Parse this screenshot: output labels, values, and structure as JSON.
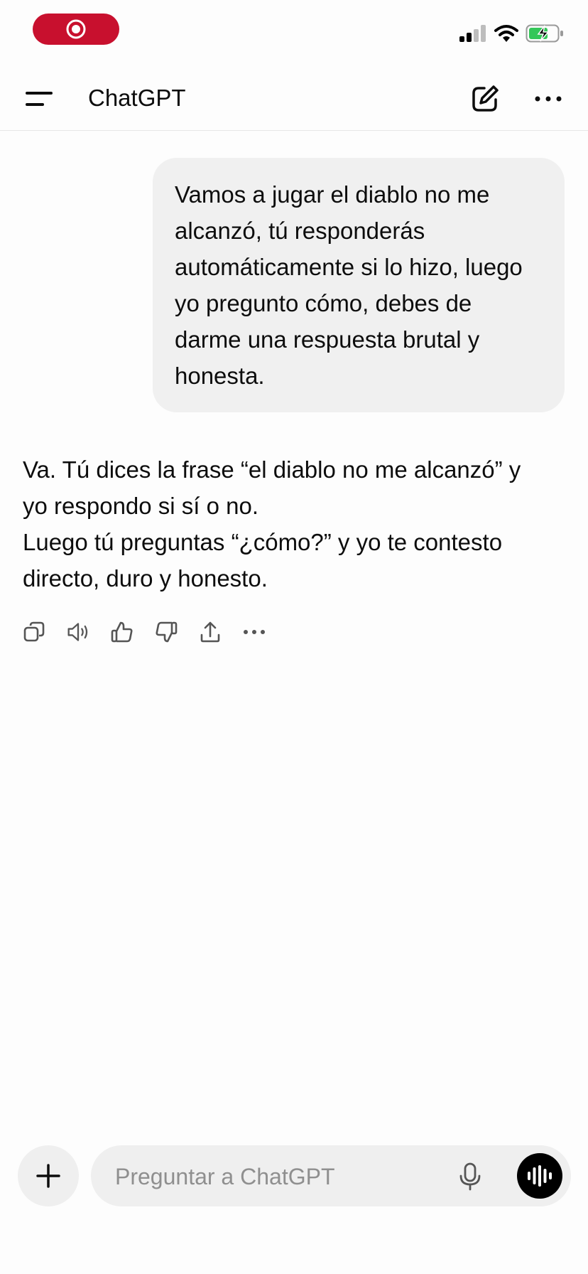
{
  "app": {
    "title": "ChatGPT"
  },
  "status_bar": {
    "recording": true,
    "battery": "charging"
  },
  "conversation": {
    "user_message": "Vamos a jugar el diablo no me alcanzó, tú responderás automáticamente si lo hizo, luego yo pregunto cómo, debes de darme una respuesta brutal y honesta.",
    "assistant_message_line1": "Va. Tú dices la frase “el diablo no me alcanzó” y yo respondo si sí o no.",
    "assistant_message_line2": "Luego tú preguntas “¿cómo?” y yo te contesto directo, duro y honesto."
  },
  "message_actions": [
    "copy-icon",
    "speaker-icon",
    "thumbs-up-icon",
    "thumbs-down-icon",
    "share-icon",
    "more-icon"
  ],
  "composer": {
    "placeholder": "Preguntar a ChatGPT"
  },
  "colors": {
    "record": "#c8102e",
    "bubble": "#f0f0f0",
    "composer": "#efefef",
    "battery_fill": "#34c759"
  }
}
